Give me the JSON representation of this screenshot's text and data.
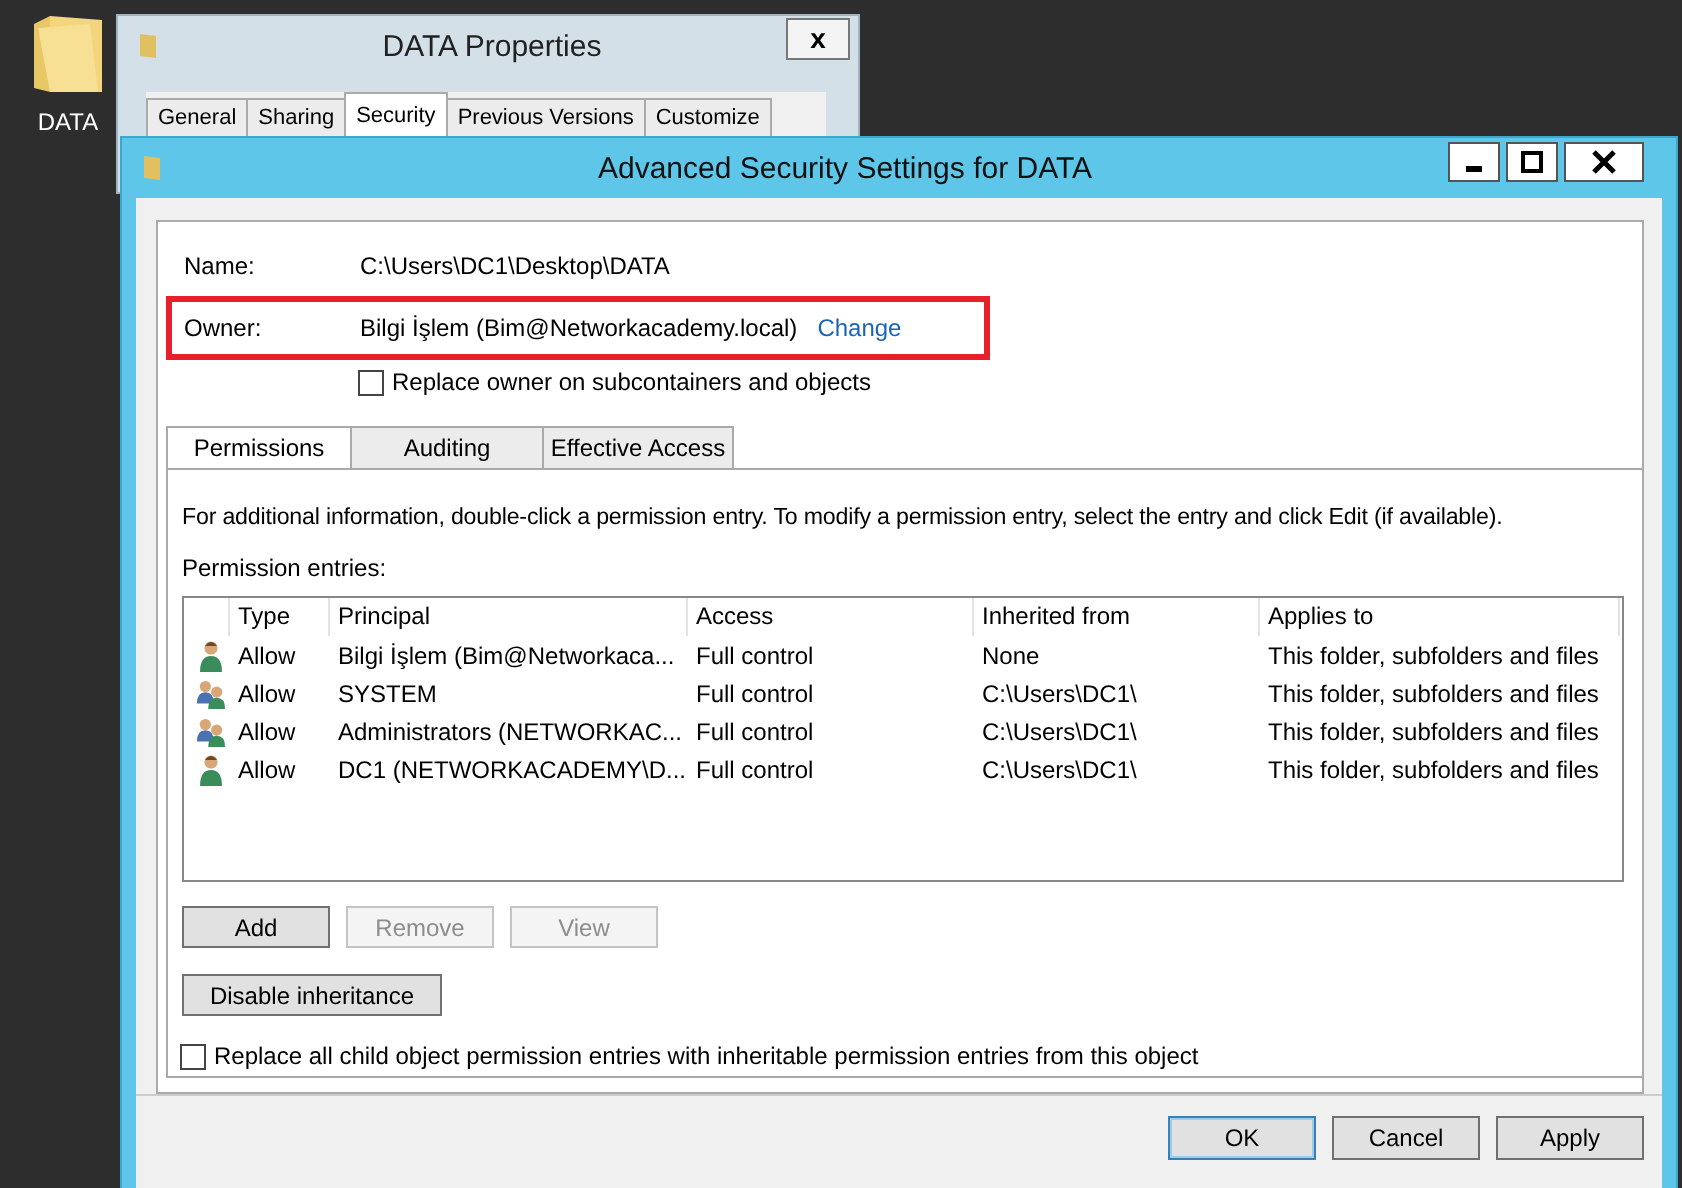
{
  "desktop_icon": {
    "label": "DATA"
  },
  "background_window": {
    "title": "DATA Properties",
    "close": "x",
    "tabs": [
      {
        "label": "General",
        "selected": false
      },
      {
        "label": "Sharing",
        "selected": false
      },
      {
        "label": "Security",
        "selected": true
      },
      {
        "label": "Previous Versions",
        "selected": false
      },
      {
        "label": "Customize",
        "selected": false
      }
    ]
  },
  "window": {
    "title": "Advanced Security Settings for DATA"
  },
  "name": {
    "label": "Name:",
    "value": "C:\\Users\\DC1\\Desktop\\DATA"
  },
  "owner": {
    "label": "Owner:",
    "value": "Bilgi İşlem (Bim@Networkacademy.local)",
    "link": "Change",
    "highlighted": true
  },
  "replace_owner": {
    "label": "Replace owner on subcontainers and objects",
    "checked": false
  },
  "tabs": [
    {
      "label": "Permissions",
      "selected": true
    },
    {
      "label": "Auditing",
      "selected": false
    },
    {
      "label": "Effective Access",
      "selected": false
    }
  ],
  "info_text": "For additional information, double-click a permission entry. To modify a permission entry, select the entry and click Edit (if available).",
  "entries_label": "Permission entries:",
  "table": {
    "columns": [
      "Type",
      "Principal",
      "Access",
      "Inherited from",
      "Applies to"
    ],
    "rows": [
      {
        "kind": "user",
        "type": "Allow",
        "principal": "Bilgi İşlem (Bim@Networkaca...",
        "access": "Full control",
        "inherited_from": "None",
        "applies_to": "This folder, subfolders and files"
      },
      {
        "kind": "group",
        "type": "Allow",
        "principal": "SYSTEM",
        "access": "Full control",
        "inherited_from": "C:\\Users\\DC1\\",
        "applies_to": "This folder, subfolders and files"
      },
      {
        "kind": "group",
        "type": "Allow",
        "principal": "Administrators (NETWORKAC...",
        "access": "Full control",
        "inherited_from": "C:\\Users\\DC1\\",
        "applies_to": "This folder, subfolders and files"
      },
      {
        "kind": "user",
        "type": "Allow",
        "principal": "DC1 (NETWORKACADEMY\\D...",
        "access": "Full control",
        "inherited_from": "C:\\Users\\DC1\\",
        "applies_to": "This folder, subfolders and files"
      }
    ]
  },
  "entry_buttons": [
    {
      "label": "Add",
      "disabled": false
    },
    {
      "label": "Remove",
      "disabled": true
    },
    {
      "label": "View",
      "disabled": true
    }
  ],
  "inheritance_button": {
    "label": "Disable inheritance"
  },
  "replace_children": {
    "label": "Replace all child object permission entries with inheritable permission entries from this object",
    "checked": false
  },
  "footer_buttons": [
    {
      "label": "OK",
      "default": true
    },
    {
      "label": "Cancel",
      "default": false
    },
    {
      "label": "Apply",
      "default": false
    }
  ]
}
